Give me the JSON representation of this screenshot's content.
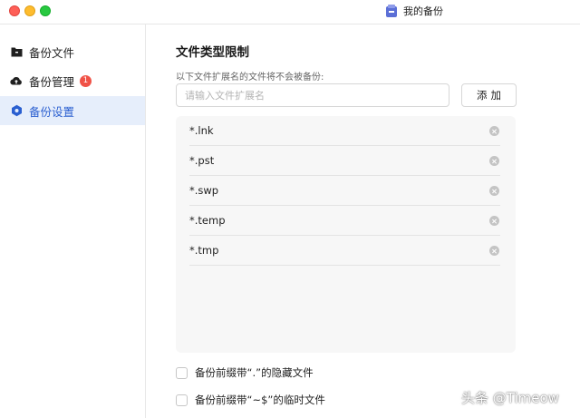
{
  "window": {
    "title": "我的备份",
    "controls": [
      "close",
      "minimize",
      "maximize"
    ]
  },
  "sidebar": {
    "items": [
      {
        "label": "备份文件",
        "icon": "folder-icon",
        "active": false
      },
      {
        "label": "备份管理",
        "icon": "cloud-upload-icon",
        "active": false,
        "badge": "1"
      },
      {
        "label": "备份设置",
        "icon": "settings-hex-icon",
        "active": true
      }
    ]
  },
  "main": {
    "section_title": "文件类型限制",
    "hint": "以下文件扩展名的文件将不会被备份:",
    "input": {
      "value": "",
      "placeholder": "请输入文件扩展名"
    },
    "add_button": "添加",
    "excluded_extensions": [
      "*.lnk",
      "*.pst",
      "*.swp",
      "*.temp",
      "*.tmp"
    ],
    "options": [
      {
        "label": "备份前缀带“.”的隐藏文件",
        "checked": false
      },
      {
        "label": "备份前缀带“~$”的临时文件",
        "checked": false
      }
    ]
  },
  "watermark": "头条 @Timeow",
  "colors": {
    "accent": "#2a5fd0",
    "active_bg": "#e6eefb",
    "badge": "#f05247",
    "panel_bg": "#f7f7f7"
  }
}
